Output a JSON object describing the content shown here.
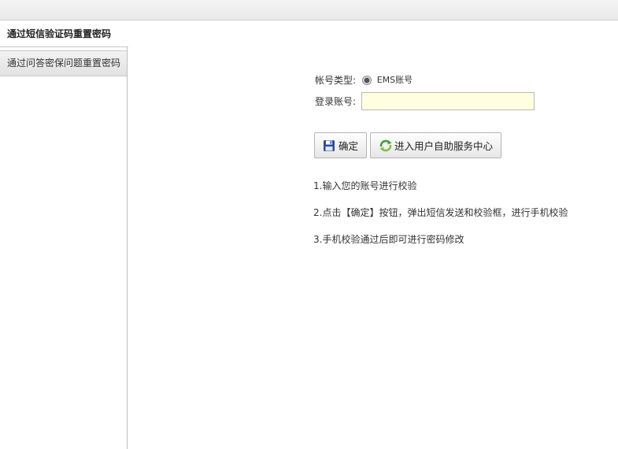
{
  "sidebar": {
    "tabs": [
      {
        "label": "通过短信验证码重置密码",
        "active": true
      },
      {
        "label": "通过问答密保问题重置密码",
        "active": false
      }
    ]
  },
  "form": {
    "account_type_label": "帐号类型:",
    "account_type_option": "EMS账号",
    "login_account_label": "登录账号:",
    "login_account_value": ""
  },
  "buttons": {
    "confirm_label": "确定",
    "self_service_label": "进入用户自助服务中心"
  },
  "tips": [
    "1.输入您的账号进行校验",
    "2.点击【确定】按钮，弹出短信发送和校验框，进行手机校验",
    "3.手机校验通过后即可进行密码修改"
  ],
  "colors": {
    "input_background": "#ffffe0",
    "save_icon": "#2c4f9e",
    "refresh_icon": "#3aa13a"
  }
}
